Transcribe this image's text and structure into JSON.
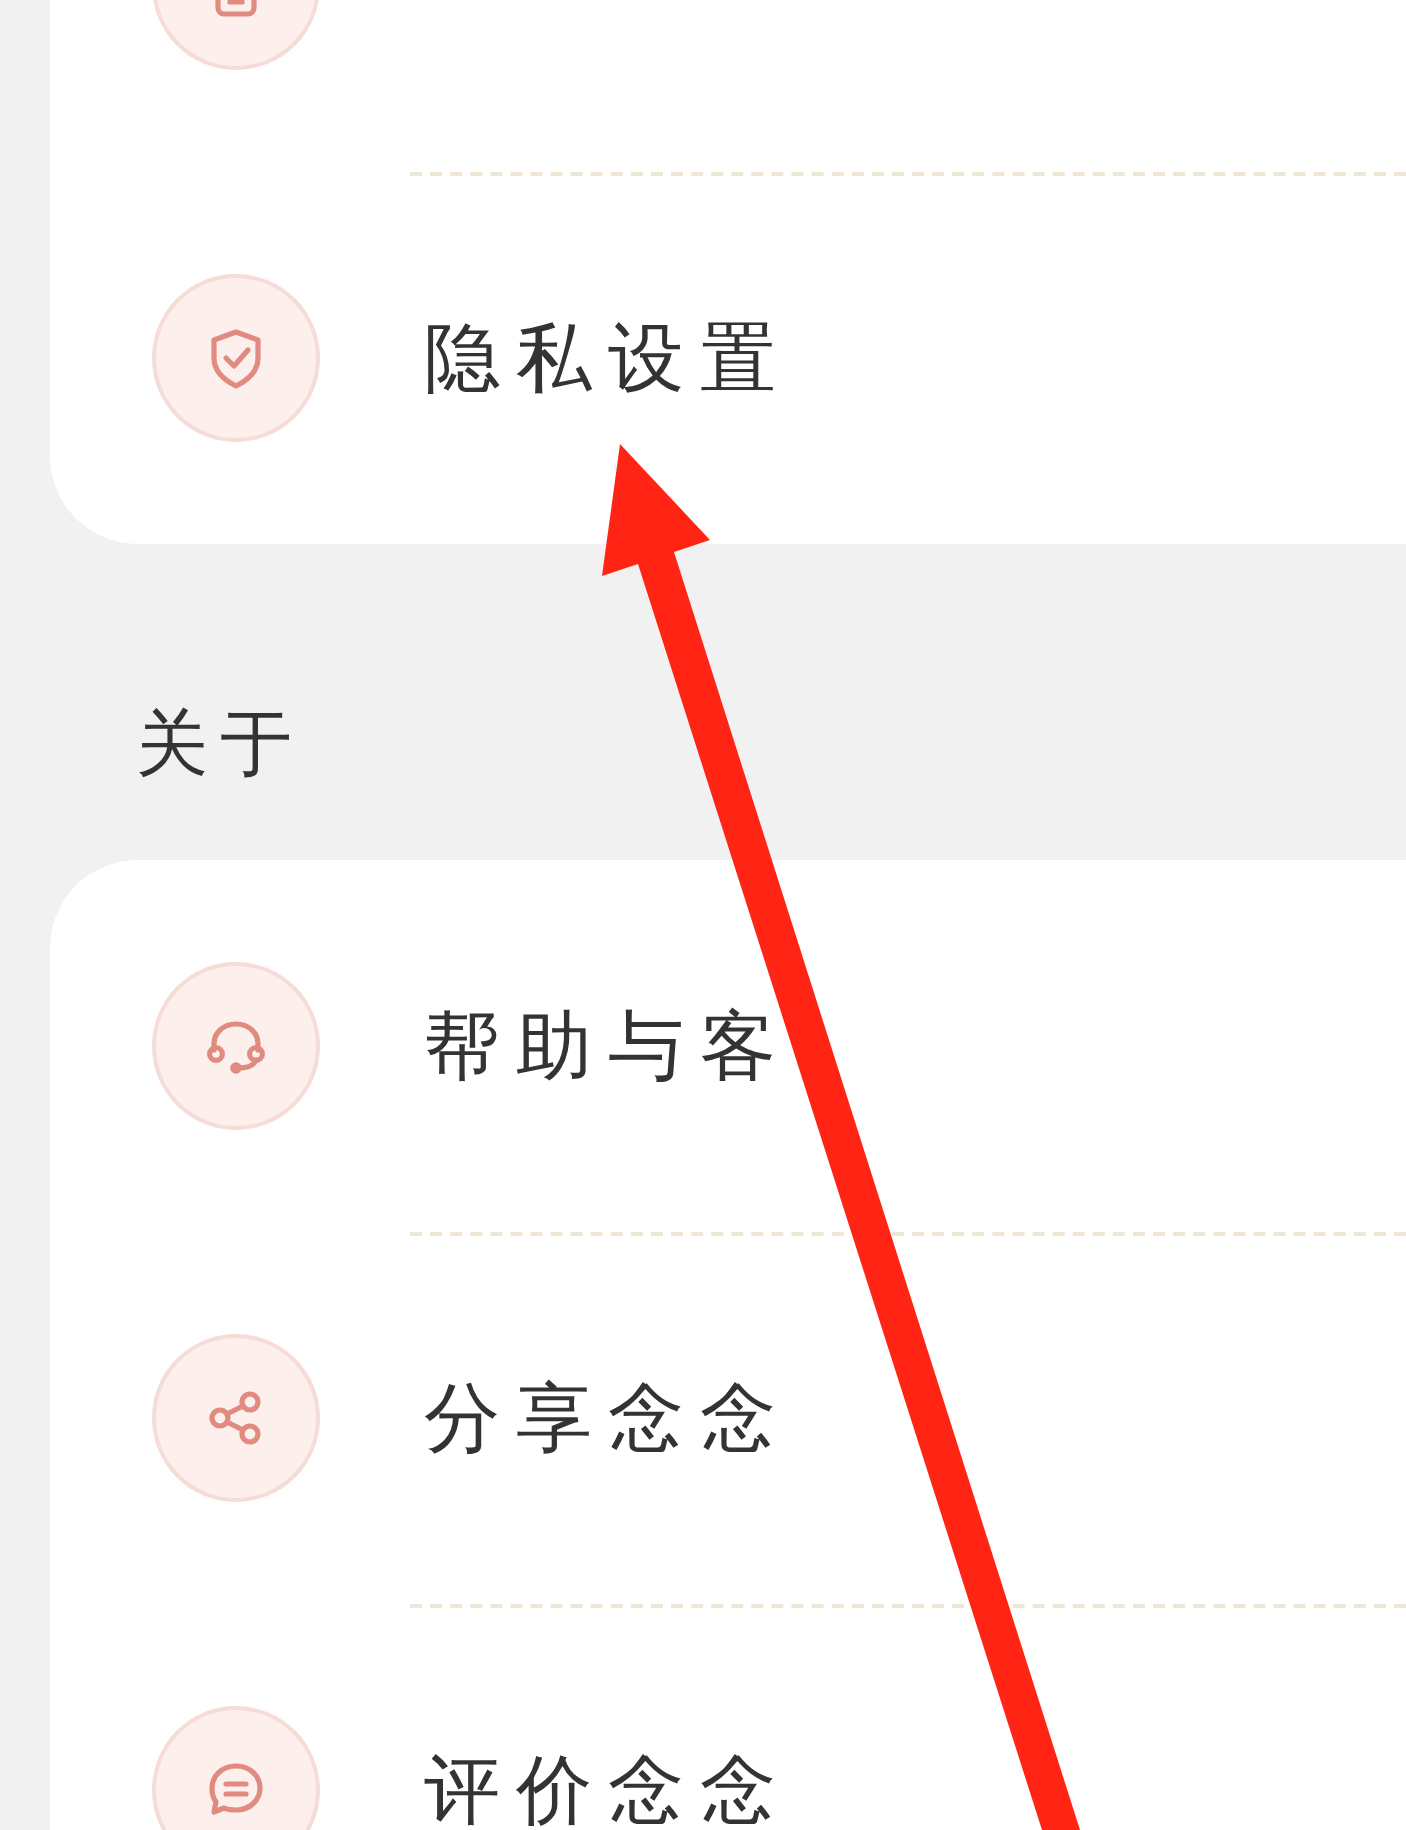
{
  "sections": [
    {
      "items": [
        {
          "kind": "cut"
        },
        {
          "kind": "entry",
          "label": "隐私设置"
        }
      ]
    },
    {
      "title": "关于",
      "items": [
        {
          "kind": "entry",
          "label": "帮助与客"
        },
        {
          "kind": "entry",
          "label": "分享念念"
        },
        {
          "kind": "entry",
          "label": "评价念念"
        }
      ]
    }
  ]
}
